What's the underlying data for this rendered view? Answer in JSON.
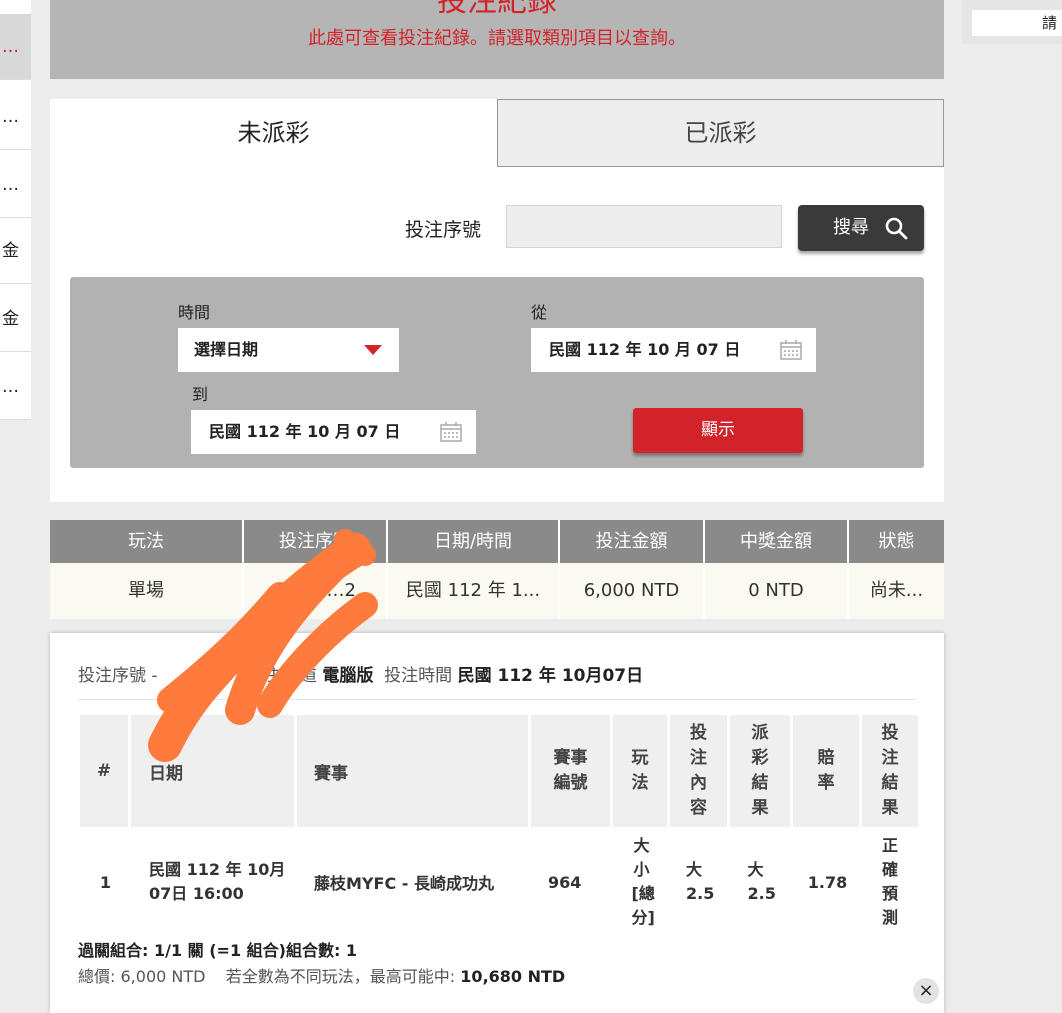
{
  "sidebar": {
    "items": [
      {
        "label": "…"
      },
      {
        "label": "…"
      },
      {
        "label": "…"
      },
      {
        "label": "金"
      },
      {
        "label": "金"
      },
      {
        "label": "…"
      }
    ]
  },
  "right_panel": {
    "input_text": "請"
  },
  "header": {
    "title": "投注紀錄",
    "subtitle": "此處可查看投注紀錄。請選取類別項目以查詢。"
  },
  "tabs": [
    {
      "label": "未派彩",
      "active": true
    },
    {
      "label": "已派彩",
      "active": false
    }
  ],
  "search": {
    "label": "投注序號",
    "value": "",
    "button_label": "搜尋",
    "icon": "search-icon"
  },
  "filter": {
    "time_label": "時間",
    "time_select_value": "選擇日期",
    "from_label": "從",
    "from_value": "民國 112 年 10 月 07 日",
    "to_label": "到",
    "to_value": "民國 112 年 10 月 07 日",
    "show_button": "顯示",
    "calendar_icon": "calendar-icon",
    "dropdown_color": "#d3232a"
  },
  "summary_table": {
    "headers": [
      "玩法",
      "投注序號",
      "日期/時間",
      "投注金額",
      "中獎金額",
      "狀態"
    ],
    "row": [
      "單場",
      "…2",
      "民國 112 年 1...",
      "6,000 NTD",
      "0 NTD",
      "尚未..."
    ]
  },
  "detail": {
    "info_label1": "投注序號",
    "info_value1": "-",
    "info_label2": "注",
    "info_label3": "道",
    "info_value3": "電腦版",
    "info_label4": "投注時間",
    "info_value4": "民國 112 年 10月07日",
    "table_headers": {
      "num": "#",
      "date": "日期",
      "match": "賽事",
      "match_no": "賽事編號",
      "play": "玩法",
      "bet_content": "投注內容",
      "payout_result": "派彩結果",
      "odds": "賠率",
      "bet_result": "投注結果"
    },
    "row": {
      "num": "1",
      "date": "民國 112 年 10月07日 16:00",
      "match": "藤枝MYFC - 長崎成功丸",
      "match_no": "964",
      "play": "大小[總分]",
      "bet_content": "大2.5",
      "payout_result": "大2.5",
      "odds": "1.78",
      "bet_result": "正確預測"
    },
    "combo_line": "過關組合: 1/1 關 (=1 組合)組合數: 1",
    "total_label": "總價:",
    "total_value": "6,000 NTD",
    "max_label": "若全數為不同玩法，最高可能中:",
    "max_value": "10,680 NTD"
  },
  "close_label": "×",
  "colors": {
    "accent_red": "#d3232a",
    "header_gray": "#b5b5b5",
    "table_header_gray": "#8a8a8a",
    "redaction_orange": "#ff7a3d"
  }
}
